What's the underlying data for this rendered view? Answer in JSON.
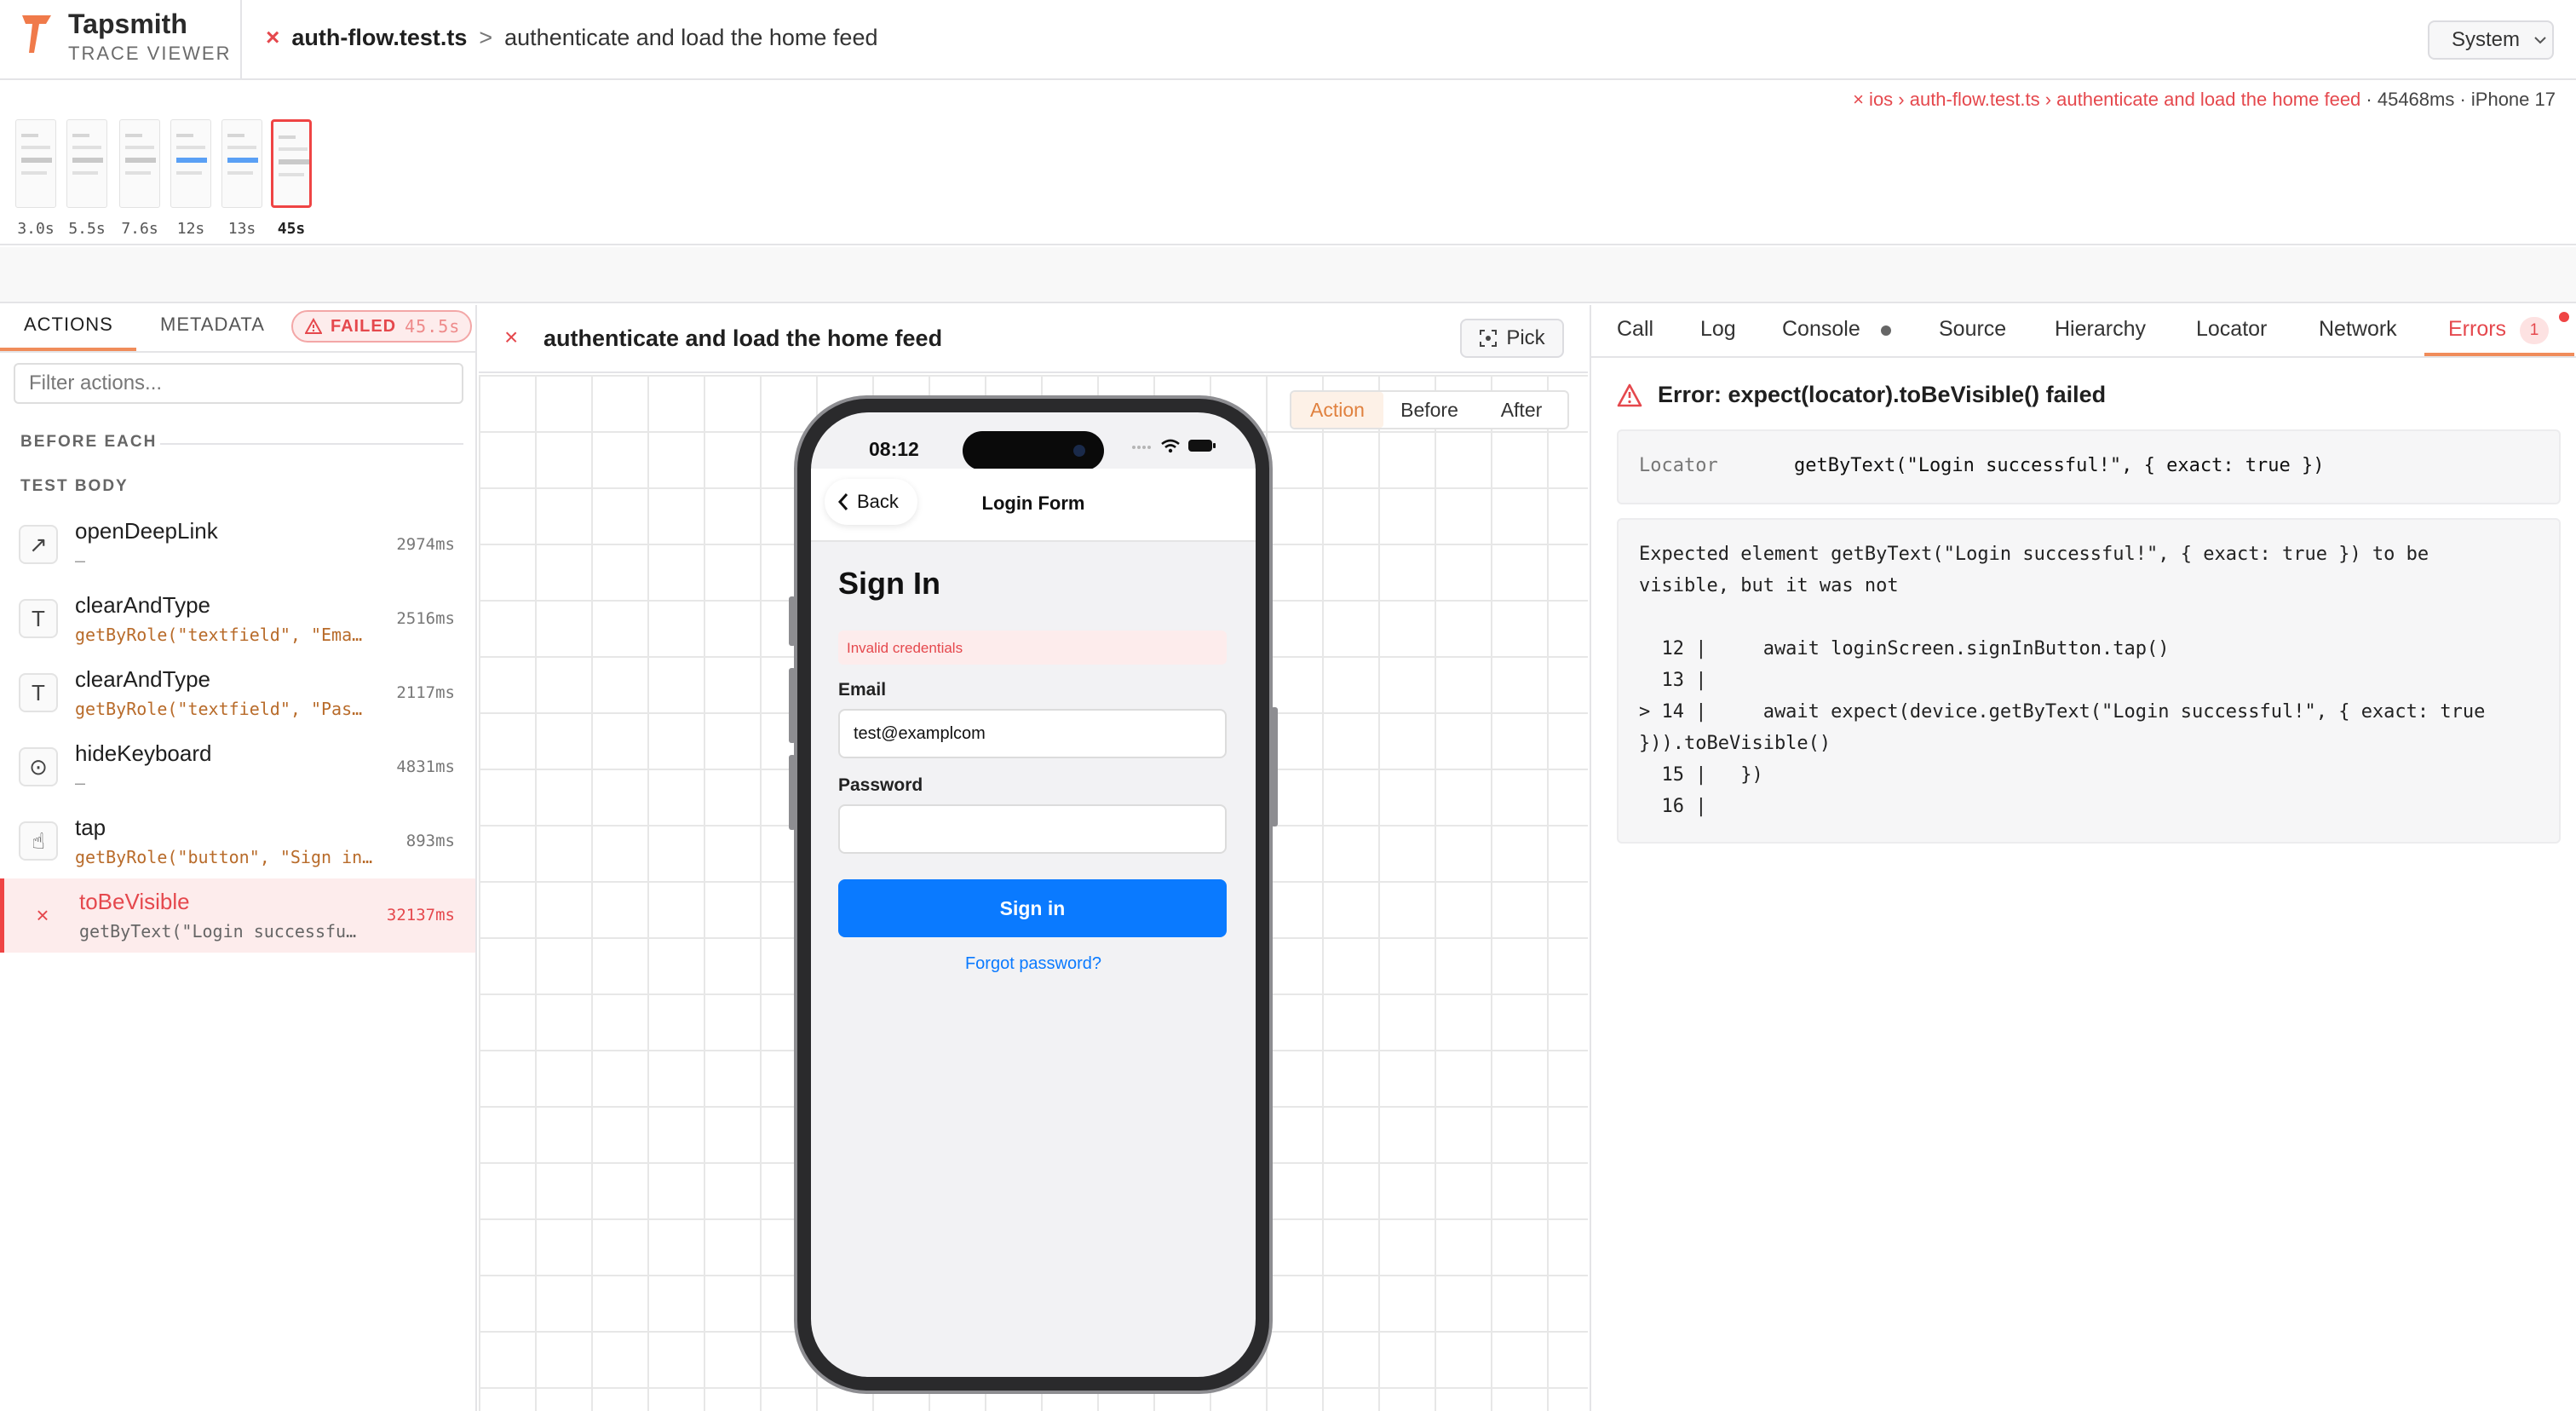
{
  "app": {
    "brand_name": "Tapsmith",
    "brand_sub": "TRACE VIEWER",
    "accent_color": "#f08c5a",
    "error_color": "#e5484d"
  },
  "header": {
    "fail_icon": "×",
    "file": "auth-flow.test.ts",
    "sep": ">",
    "test_title": "authenticate and load the home feed",
    "theme": "System"
  },
  "run_info": {
    "error_path": "× ios › auth-flow.test.ts › authenticate and load the home feed",
    "meta": " · 45468ms · iPhone 17"
  },
  "filmstrip": [
    {
      "label": "3.0s",
      "style": "gray"
    },
    {
      "label": "5.5s",
      "style": "gray"
    },
    {
      "label": "7.6s",
      "style": "gray"
    },
    {
      "label": "12s",
      "style": "blue"
    },
    {
      "label": "13s",
      "style": "blue"
    },
    {
      "label": "45s",
      "style": "selected"
    }
  ],
  "left": {
    "tabs": {
      "actions": "ACTIONS",
      "metadata": "METADATA"
    },
    "failed_badge": {
      "label": "FAILED",
      "duration": "45.5s"
    },
    "filter_placeholder": "Filter actions...",
    "sections": {
      "before_each": "BEFORE EACH",
      "test_body": "TEST BODY"
    },
    "actions": [
      {
        "icon": "external-link-icon",
        "glyph": "↗",
        "name": "openDeepLink",
        "sub": "—",
        "time": "2974ms",
        "status": "ok"
      },
      {
        "icon": "text-icon",
        "glyph": "T",
        "name": "clearAndType",
        "sub": "getByRole(\"textfield\", \"Ema…",
        "time": "2516ms",
        "status": "ok"
      },
      {
        "icon": "text-icon",
        "glyph": "T",
        "name": "clearAndType",
        "sub": "getByRole(\"textfield\", \"Pas…",
        "time": "2117ms",
        "status": "ok"
      },
      {
        "icon": "keyboard-hide-icon",
        "glyph": "⊙",
        "name": "hideKeyboard",
        "sub": "—",
        "time": "4831ms",
        "status": "ok"
      },
      {
        "icon": "tap-hand-icon",
        "glyph": "☝",
        "name": "tap",
        "sub": "getByRole(\"button\", \"Sign in…",
        "time": "893ms",
        "status": "ok"
      },
      {
        "icon": "fail-x-icon",
        "glyph": "×",
        "name": "toBeVisible",
        "sub": "getByText(\"Login successfu…",
        "time": "32137ms",
        "status": "failed"
      }
    ]
  },
  "center": {
    "fail_icon": "×",
    "title": "authenticate and load the home feed",
    "pick_label": "Pick",
    "snapshot_tabs": [
      "Action",
      "Before",
      "After"
    ],
    "active_snapshot": "Action"
  },
  "device": {
    "status_time": "08:12",
    "back_label": "Back",
    "nav_title": "Login Form",
    "heading": "Sign In",
    "error_banner": "Invalid credentials",
    "email_label": "Email",
    "email_value": "test@examplcom",
    "password_label": "Password",
    "password_value": "",
    "signin_label": "Sign in",
    "forgot_label": "Forgot password?",
    "primary_color": "#0a7aff"
  },
  "right": {
    "tabs": [
      "Call",
      "Log",
      "Console",
      "Source",
      "Hierarchy",
      "Locator",
      "Network",
      "Errors"
    ],
    "active_tab": "Errors",
    "errors_count": "1",
    "error_title": "Error: expect(locator).toBeVisible() failed",
    "locator_key": "Locator",
    "locator_value": "getByText(\"Login successful!\", { exact: true })",
    "message_lines": [
      "Expected element getByText(\"Login successful!\", { exact: true }) to be",
      "visible, but it was not",
      "",
      "  12 |     await loginScreen.signInButton.tap()",
      "  13 |",
      "> 14 |     await expect(device.getByText(\"Login successful!\", { exact: true",
      "})).toBeVisible()",
      "  15 |   })",
      "  16 |"
    ]
  }
}
